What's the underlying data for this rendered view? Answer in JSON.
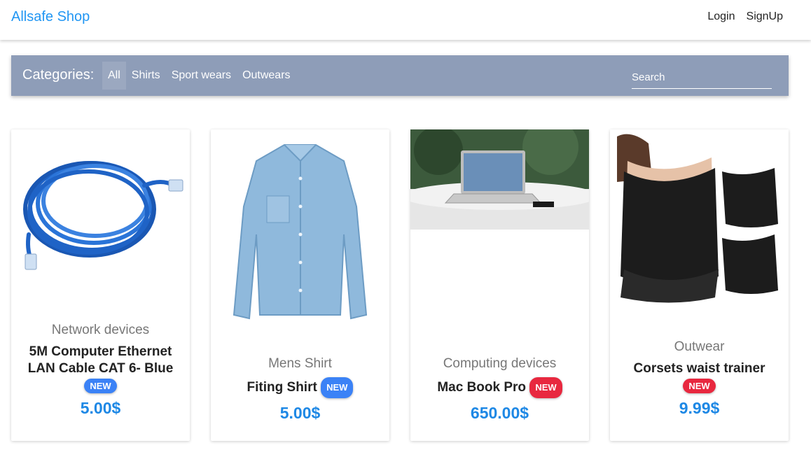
{
  "navbar": {
    "brand": "Allsafe Shop",
    "login": "Login",
    "signup": "SignUp"
  },
  "categories": {
    "title": "Categories:",
    "tabs": [
      {
        "label": "All",
        "active": true
      },
      {
        "label": "Shirts",
        "active": false
      },
      {
        "label": "Sport wears",
        "active": false
      },
      {
        "label": "Outwears",
        "active": false
      }
    ],
    "search_placeholder": "Search"
  },
  "products": [
    {
      "category": "Network devices",
      "title_line1": "5M Computer Ethernet",
      "title_line2": "LAN Cable CAT 6- Blue",
      "badge": "NEW",
      "badge_color": "#3b82f6",
      "price": "5.00$",
      "image": "blue-ethernet-cable"
    },
    {
      "category": "Mens Shirt",
      "title": "Fiting Shirt",
      "badge": "NEW",
      "badge_color": "#3b82f6",
      "price": "5.00$",
      "image": "denim-shirt"
    },
    {
      "category": "Computing devices",
      "title": "Mac Book Pro",
      "badge": "NEW",
      "badge_color": "#e8283f",
      "price": "650.00$",
      "image": "laptop-on-table"
    },
    {
      "category": "Outwear",
      "title": "Corsets waist trainer",
      "badge": "NEW",
      "badge_color": "#e8283f",
      "price": "9.99$",
      "image": "black-corset"
    }
  ],
  "colors": {
    "brand": "#2196f3",
    "category_bar": "#8e9db8",
    "price": "#1e88e5"
  }
}
